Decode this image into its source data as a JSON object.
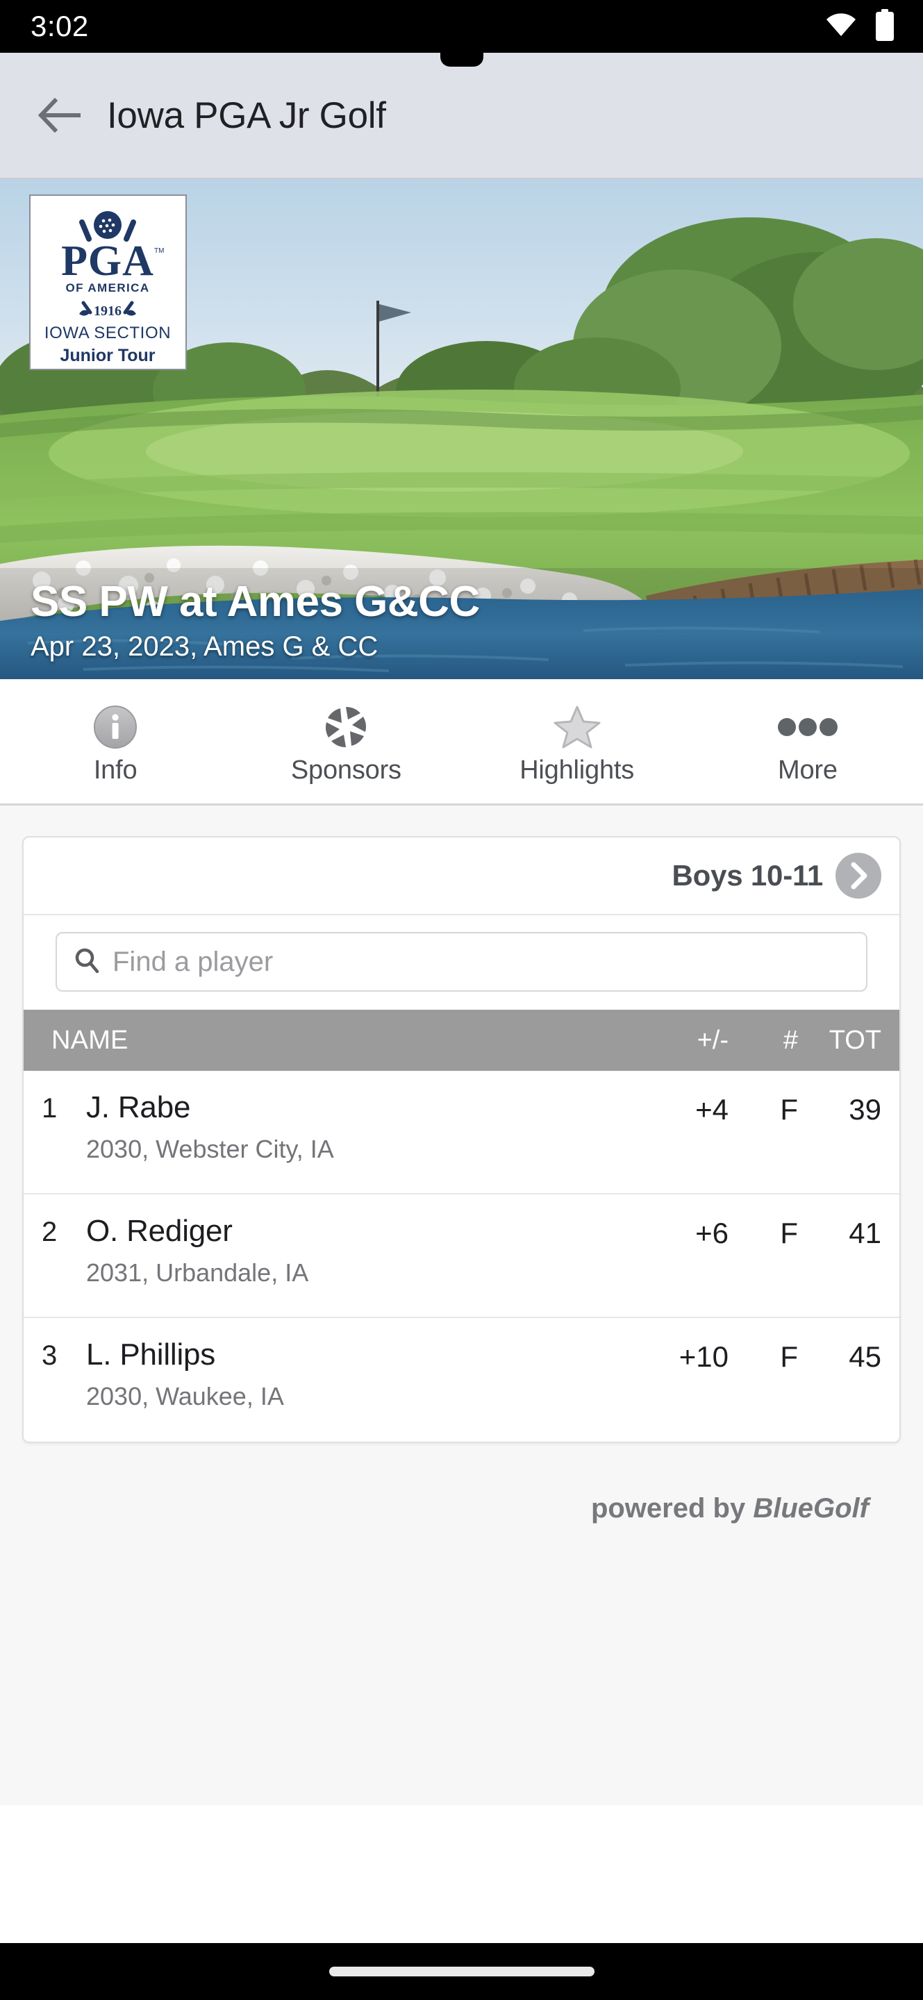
{
  "status_bar": {
    "time": "3:02",
    "icons": [
      "wifi-icon",
      "battery-icon"
    ]
  },
  "app_bar": {
    "back_icon": "back-arrow-icon",
    "title": "Iowa PGA Jr Golf"
  },
  "hero": {
    "logo": {
      "brand": "PGA",
      "line1": "OF AMERICA",
      "year": "1916",
      "line2": "IOWA SECTION",
      "line3": "Junior Tour",
      "tm": "TM"
    },
    "title": "SS PW at Ames G&CC",
    "subtitle": "Apr 23, 2023, Ames G & CC"
  },
  "tabs": [
    {
      "label": "Info",
      "icon": "info-circle-icon"
    },
    {
      "label": "Sponsors",
      "icon": "aperture-icon"
    },
    {
      "label": "Highlights",
      "icon": "star-outline-icon"
    },
    {
      "label": "More",
      "icon": "ellipsis-icon"
    }
  ],
  "leaderboard": {
    "division": "Boys 10-11",
    "division_next_icon": "chevron-right-icon",
    "search": {
      "icon": "search-icon",
      "placeholder": "Find a player",
      "value": ""
    },
    "columns": {
      "name": "NAME",
      "plus_minus": "+/-",
      "hole": "#",
      "total": "TOT"
    },
    "rows": [
      {
        "rank": "1",
        "name": "J. Rabe",
        "meta": "2030, Webster City, IA",
        "plus_minus": "+4",
        "hole": "F",
        "total": "39"
      },
      {
        "rank": "2",
        "name": "O. Rediger",
        "meta": "2031, Urbandale, IA",
        "plus_minus": "+6",
        "hole": "F",
        "total": "41"
      },
      {
        "rank": "3",
        "name": "L. Phillips",
        "meta": "2030, Waukee, IA",
        "plus_minus": "+10",
        "hole": "F",
        "total": "45"
      }
    ]
  },
  "footer": {
    "prefix": "powered by ",
    "brand": "BlueGolf"
  },
  "colors": {
    "status_bar_bg": "#000000",
    "app_bar_bg": "#dfe1e8",
    "table_header_bg": "#9b9b9b",
    "page_bg": "#f7f7f8",
    "logo_navy": "#1f3864",
    "muted_text": "#747479"
  }
}
